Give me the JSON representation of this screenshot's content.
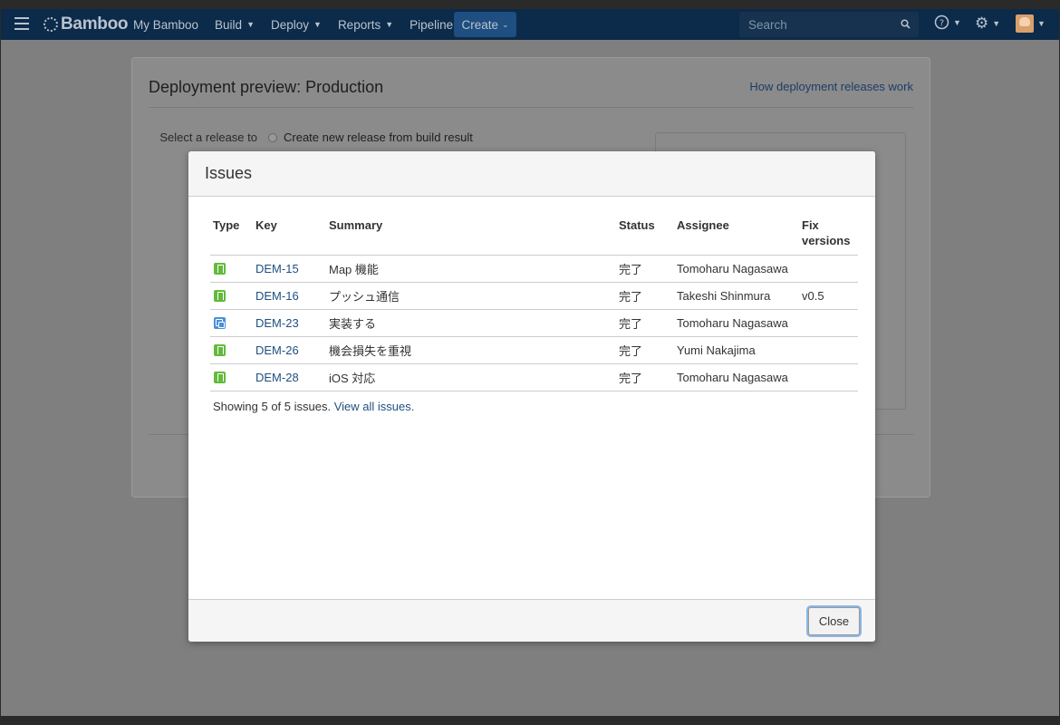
{
  "header": {
    "logo": "Bamboo",
    "nav": [
      {
        "label": "My Bamboo",
        "caret": false
      },
      {
        "label": "Build",
        "caret": true
      },
      {
        "label": "Deploy",
        "caret": true
      },
      {
        "label": "Reports",
        "caret": true
      },
      {
        "label": "Pipeline",
        "caret": false
      }
    ],
    "create_label": "Create",
    "search_placeholder": "Search"
  },
  "page": {
    "title": "Deployment preview: Production",
    "help_link": "How deployment releases work",
    "select_label": "Select a release to deploy",
    "radio_label": "Create new release from build result"
  },
  "modal": {
    "title": "Issues",
    "columns": [
      "Type",
      "Key",
      "Summary",
      "Status",
      "Assignee",
      "Fix versions"
    ],
    "rows": [
      {
        "type": "story-icon",
        "key": "DEM-15",
        "summary": "Map 機能",
        "status": "完了",
        "assignee": "Tomoharu Nagasawa",
        "fix": ""
      },
      {
        "type": "story-icon",
        "key": "DEM-16",
        "summary": "プッシュ通信",
        "status": "完了",
        "assignee": "Takeshi Shinmura",
        "fix": "v0.5"
      },
      {
        "type": "subtask-icon",
        "key": "DEM-23",
        "summary": "実装する",
        "status": "完了",
        "assignee": "Tomoharu Nagasawa",
        "fix": ""
      },
      {
        "type": "story-icon",
        "key": "DEM-26",
        "summary": "機会損失を重視",
        "status": "完了",
        "assignee": "Yumi Nakajima",
        "fix": ""
      },
      {
        "type": "story-icon",
        "key": "DEM-28",
        "summary": "iOS 対応",
        "status": "完了",
        "assignee": "Tomoharu Nagasawa",
        "fix": ""
      }
    ],
    "showing_text": "Showing 5 of 5 issues.",
    "view_all_link": "View all issues.",
    "close_label": "Close"
  }
}
